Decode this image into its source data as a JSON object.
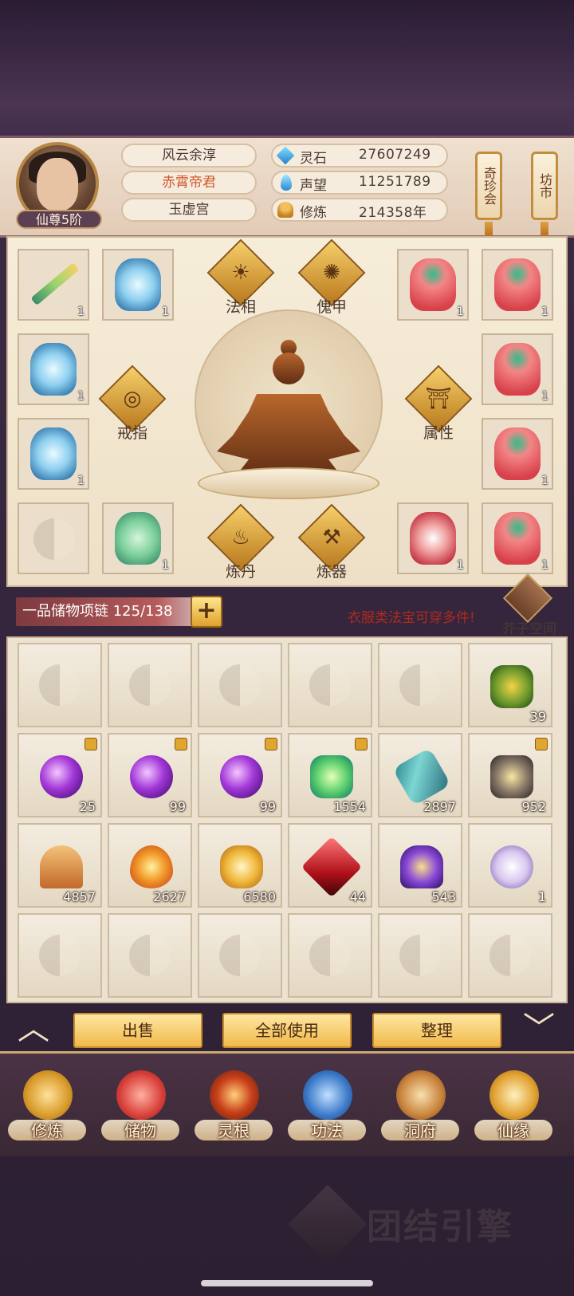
{
  "player": {
    "name": "风云余淳",
    "title": "赤霄帝君",
    "sect": "玉虚宫",
    "rank": "仙尊5阶"
  },
  "stats": [
    {
      "icon": "spirit-stone-icon",
      "label": "灵石",
      "value": "27607249"
    },
    {
      "icon": "reputation-icon",
      "label": "声望",
      "value": "11251789"
    },
    {
      "icon": "cultivation-icon",
      "label": "修炼",
      "value": "214358年"
    }
  ],
  "side_buttons": {
    "treasure_fair": "奇珍会",
    "market": "坊市"
  },
  "equipment": {
    "slot_counts": {
      "weapon": "1",
      "armor_ice_1": "1",
      "armor_red_1": "1",
      "armor_red_2": "1",
      "armor_ice_2": "1",
      "armor_red_3": "1",
      "armor_ice_3": "1",
      "armor_red_4": "1",
      "armor_green": "1",
      "armor_rw": "1",
      "armor_red_5": "1"
    },
    "functions": {
      "dharma": "法相",
      "puppet": "傀甲",
      "ring": "戒指",
      "attributes": "属性",
      "alchemy": "炼丹",
      "forging": "炼器"
    }
  },
  "storage": {
    "container": "一品储物项链 125/138",
    "hint": "衣服类法宝可穿多件!",
    "space_label": "芥子空间",
    "items": [
      {
        "count": "",
        "kind": "empty",
        "locked": false
      },
      {
        "count": "",
        "kind": "empty",
        "locked": false
      },
      {
        "count": "",
        "kind": "empty",
        "locked": false
      },
      {
        "count": "",
        "kind": "empty",
        "locked": false
      },
      {
        "count": "",
        "kind": "empty",
        "locked": false
      },
      {
        "count": "39",
        "kind": "herb",
        "locked": false
      },
      {
        "count": "25",
        "kind": "purple-orb",
        "locked": true
      },
      {
        "count": "99",
        "kind": "purple-orb",
        "locked": true
      },
      {
        "count": "99",
        "kind": "purple-orb",
        "locked": true
      },
      {
        "count": "1554",
        "kind": "green-grass",
        "locked": true
      },
      {
        "count": "2897",
        "kind": "scroll",
        "locked": false
      },
      {
        "count": "952",
        "kind": "ore",
        "locked": true
      },
      {
        "count": "4857",
        "kind": "sand",
        "locked": false
      },
      {
        "count": "2627",
        "kind": "fire-drop",
        "locked": false
      },
      {
        "count": "6580",
        "kind": "gold-cloud",
        "locked": false
      },
      {
        "count": "44",
        "kind": "red-crystal",
        "locked": false
      },
      {
        "count": "543",
        "kind": "purple-hat",
        "locked": false
      },
      {
        "count": "1",
        "kind": "taiji-orb",
        "locked": false
      },
      {
        "count": "",
        "kind": "empty",
        "locked": false
      },
      {
        "count": "",
        "kind": "empty",
        "locked": false
      },
      {
        "count": "",
        "kind": "empty",
        "locked": false
      },
      {
        "count": "",
        "kind": "empty",
        "locked": false
      },
      {
        "count": "",
        "kind": "empty",
        "locked": false
      },
      {
        "count": "",
        "kind": "empty",
        "locked": false
      }
    ]
  },
  "actions": {
    "sell": "出售",
    "use_all": "全部使用",
    "sort": "整理"
  },
  "nav": [
    {
      "label": "修炼",
      "icon": "cultivate-icon"
    },
    {
      "label": "储物",
      "icon": "storage-bag-icon"
    },
    {
      "label": "灵根",
      "icon": "spirit-root-icon"
    },
    {
      "label": "功法",
      "icon": "technique-book-icon"
    },
    {
      "label": "洞府",
      "icon": "cave-abode-icon"
    },
    {
      "label": "仙缘",
      "icon": "fortune-gourd-icon"
    }
  ],
  "watermark": "团结引擎"
}
